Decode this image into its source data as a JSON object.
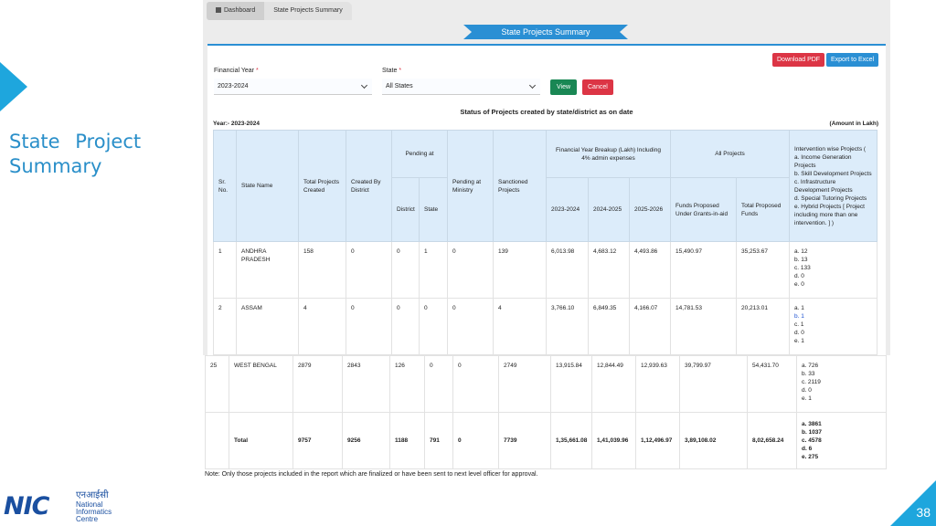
{
  "slide": {
    "title": "State Project Summary",
    "page_number": "38",
    "accent_color": "#1ea6dd"
  },
  "logo": {
    "mark": "NIC",
    "hindi": "एनआईसी",
    "line1": "National",
    "line2": "Informatics",
    "line3": "Centre"
  },
  "breadcrumb": {
    "home": "Dashboard",
    "current": "State Projects Summary"
  },
  "ribbon_title": "State Projects Summary",
  "buttons": {
    "download_pdf": "Download PDF",
    "export_excel": "Export to Excel",
    "view": "View",
    "cancel": "Cancel"
  },
  "filters": {
    "fy_label": "Financial Year",
    "fy_value": "2023-2024",
    "state_label": "State",
    "state_value": "All States",
    "required_mark": "*"
  },
  "report": {
    "heading": "Status of Projects created by state/district as on date",
    "year_label": "Year:- 2023-2024",
    "amount_unit": "(Amount in Lakh)"
  },
  "headers": {
    "sr": "Sr. No.",
    "state_name": "State Name",
    "total_created": "Total Projects Created",
    "created_by_district": "Created By District",
    "pending_at": "Pending at",
    "district": "District",
    "state": "State",
    "pending_ministry": "Pending at Ministry",
    "sanctioned": "Sanctioned Projects",
    "fy_breakup": "Financial Year Breakup (Lakh) Including 4% admin expenses",
    "fy1": "2023-2024",
    "fy2": "2024-2025",
    "fy3": "2025-2026",
    "all_projects": "All Projects",
    "funds_proposed": "Funds Proposed Under Grants-in-aid",
    "total_funds": "Total Proposed Funds",
    "intervention_title": "Intervention wise Projects (",
    "intervention_a": "a. Income Generation Projects",
    "intervention_b": "b. Skill Development Projects",
    "intervention_c": "c. Infrastructure Development Projects",
    "intervention_d": "d. Special Tutoring Projects",
    "intervention_e": "e. Hybrid Projects [ Project including more than one intervention. ] )"
  },
  "rows": [
    {
      "sr": "1",
      "state": "ANDHRA PRADESH",
      "total": "158",
      "by_district": "0",
      "district": "0",
      "state_pending": "1",
      "ministry": "0",
      "sanctioned": "139",
      "fy1": "6,013.98",
      "fy2": "4,683.12",
      "fy3": "4,493.86",
      "funds": "15,490.97",
      "total_funds": "35,253.67",
      "iw_a": "a. 12",
      "iw_b": "b. 13",
      "iw_c": "c. 133",
      "iw_d": "d. 0",
      "iw_e": "e. 0"
    },
    {
      "sr": "2",
      "state": "ASSAM",
      "total": "4",
      "by_district": "0",
      "district": "0",
      "state_pending": "0",
      "ministry": "0",
      "sanctioned": "4",
      "fy1": "3,766.10",
      "fy2": "6,849.35",
      "fy3": "4,166.07",
      "funds": "14,781.53",
      "total_funds": "20,213.01",
      "iw_a": "a. 1",
      "iw_b": "b. 1",
      "iw_c": "c. 1",
      "iw_d": "d. 0",
      "iw_e": "e. 1"
    },
    {
      "sr": "25",
      "state": "WEST BENGAL",
      "total": "2879",
      "by_district": "2843",
      "district": "126",
      "state_pending": "0",
      "ministry": "0",
      "sanctioned": "2749",
      "fy1": "13,915.84",
      "fy2": "12,844.49",
      "fy3": "12,939.63",
      "funds": "39,799.97",
      "total_funds": "54,431.70",
      "iw_a": "a. 726",
      "iw_b": "b. 33",
      "iw_c": "c. 2119",
      "iw_d": "d. 0",
      "iw_e": "e. 1"
    }
  ],
  "totals": {
    "label": "Total",
    "total": "9757",
    "by_district": "9256",
    "district": "1188",
    "state_pending": "791",
    "ministry": "0",
    "sanctioned": "7739",
    "fy1": "1,35,661.08",
    "fy2": "1,41,039.96",
    "fy3": "1,12,496.97",
    "funds": "3,89,108.02",
    "total_funds": "8,02,658.24",
    "iw_a": "a. 3861",
    "iw_b": "b. 1037",
    "iw_c": "c. 4578",
    "iw_d": "d. 6",
    "iw_e": "e. 275"
  },
  "note": "Note: Only those projects included in the report which are finalized or have been sent to next level officer for approval."
}
